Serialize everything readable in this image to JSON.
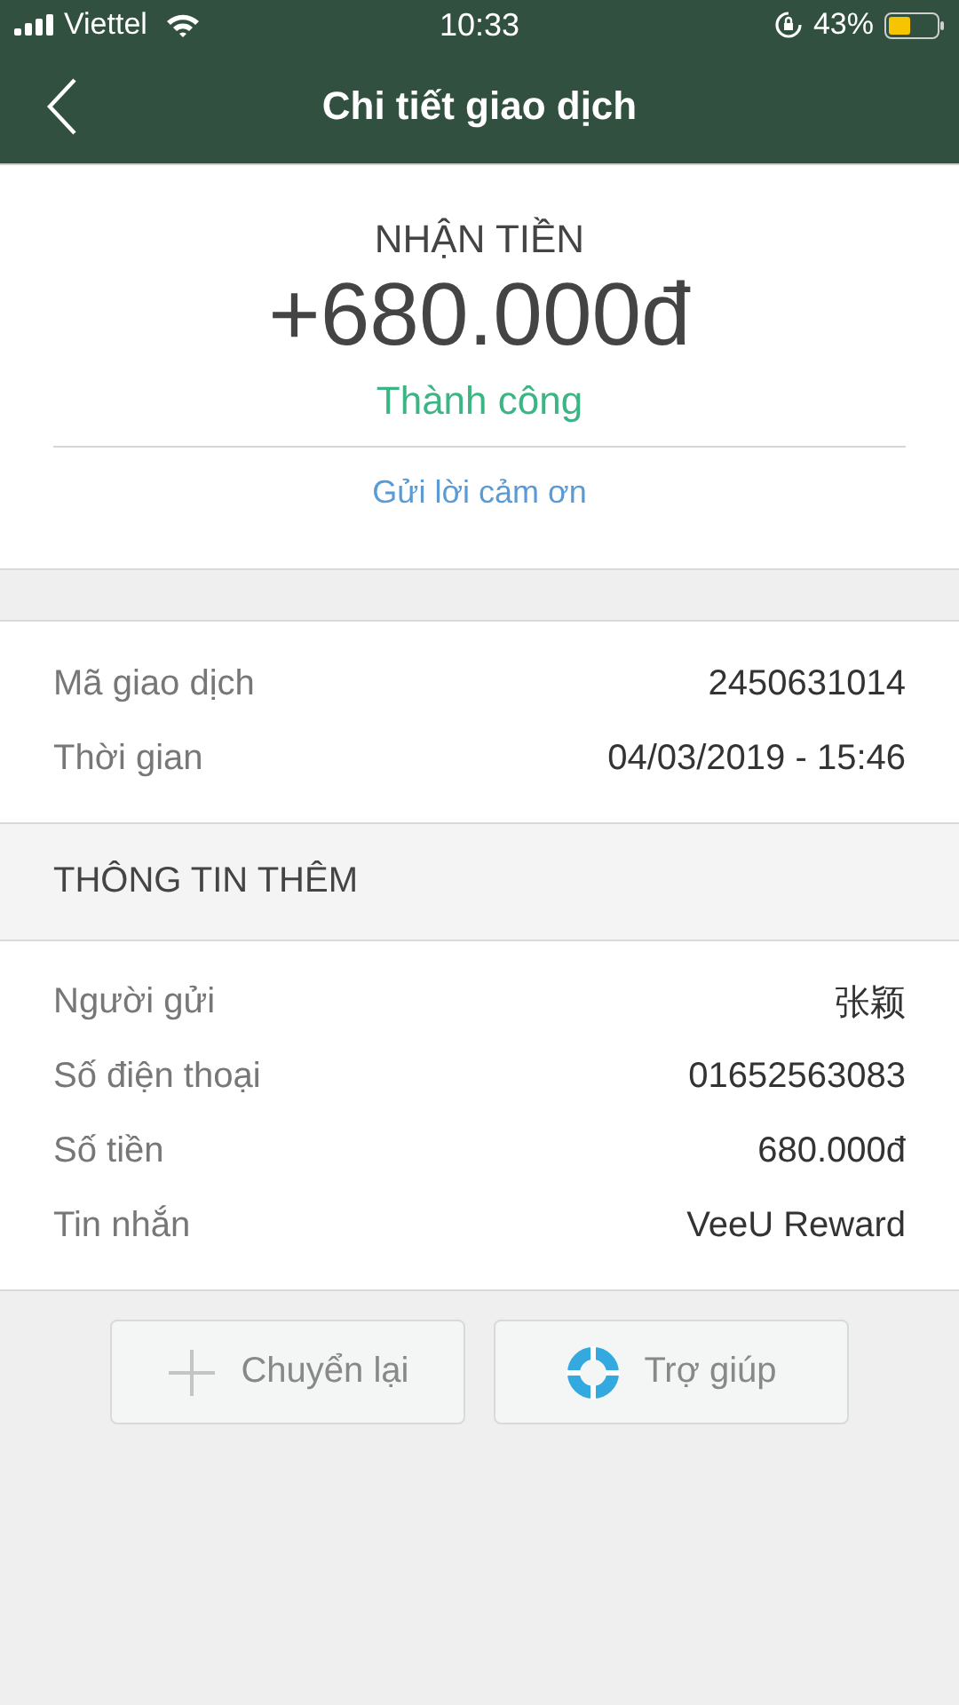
{
  "status_bar": {
    "carrier": "Viettel",
    "time": "10:33",
    "battery": "43%"
  },
  "nav": {
    "title": "Chi tiết giao dịch"
  },
  "summary": {
    "type": "NHẬN TIỀN",
    "amount": "+680.000đ",
    "status": "Thành công",
    "thanks_link": "Gửi lời cảm ơn"
  },
  "details": [
    {
      "label": "Mã giao dịch",
      "value": "2450631014"
    },
    {
      "label": "Thời gian",
      "value": "04/03/2019 - 15:46"
    }
  ],
  "extra": {
    "heading": "THÔNG TIN THÊM",
    "rows": [
      {
        "label": "Người gửi",
        "value": "张颖"
      },
      {
        "label": "Số điện thoại",
        "value": "01652563083"
      },
      {
        "label": "Số tiền",
        "value": "680.000đ"
      },
      {
        "label": "Tin nhắn",
        "value": "VeeU Reward"
      }
    ]
  },
  "buttons": [
    {
      "kind": "plus",
      "label": "Chuyển lại"
    },
    {
      "kind": "help",
      "label": "Trợ giúp"
    }
  ]
}
